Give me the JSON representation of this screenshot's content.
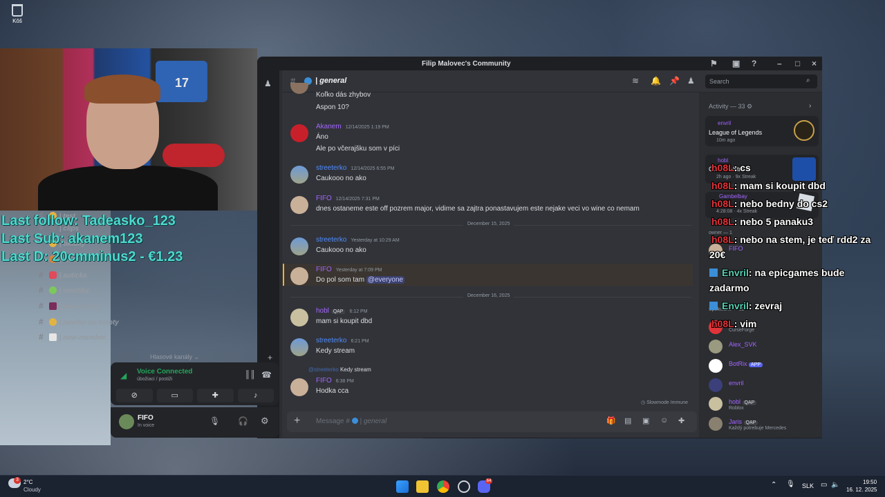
{
  "desktop": {
    "recycle_bin_label": "Kôš"
  },
  "overlay": {
    "last_follow": "Last follow: Tadeasko_123",
    "last_sub": "Last Sub: akanem123",
    "last_d": "Last D: 20cmminus2 - €1.23"
  },
  "window": {
    "title": "Filip Malovec's Community"
  },
  "channel_header": {
    "name": "| general",
    "search_placeholder": "Search"
  },
  "channels": [
    {
      "name": "| test",
      "icon": "fire-emoji"
    },
    {
      "name": "| clips",
      "icon": "film-emoji"
    },
    {
      "name": "| tiktoky",
      "icon": "smile-emoji"
    },
    {
      "name": "| food",
      "icon": "food-emoji"
    },
    {
      "name": "| auticka",
      "icon": "car-emoji"
    },
    {
      "name": "| emotiky",
      "icon": "alien-emoji"
    },
    {
      "name": "| bot-srandy",
      "icon": "hat-emoji"
    },
    {
      "name": "| navrhy-na-emoty",
      "icon": "thinking-emoji"
    },
    {
      "name": "| new-member",
      "icon": "memo-emoji"
    }
  ],
  "voice_channels_label": "Hlasové kanály",
  "mention_badge": "6",
  "voice": {
    "status": "Voice Connected",
    "location": "úbožiaci / postiži"
  },
  "user": {
    "name": "FIFO",
    "status": "In voice"
  },
  "messages": [
    {
      "author": "",
      "time": "",
      "lines": [
        "Koľko dás zhybov",
        "Aspon 10?"
      ]
    },
    {
      "author": "Akanem",
      "time": "12/14/2025 1:19 PM",
      "lines": [
        "Áno",
        "Ale po včerajšku som v píci"
      ]
    },
    {
      "author": "streeterko",
      "time": "12/14/2025 6:55 PM",
      "lines": [
        "Caukooo no ako"
      ]
    },
    {
      "author": "FIFO",
      "time": "12/14/2025 7:31 PM",
      "lines": [
        "dnes ostaneme este off pozrem major, vidime sa zajtra ponastavujem este nejake veci vo wine co nemam"
      ]
    },
    {
      "author": "streeterko",
      "time": "Yesterday at 10:29 AM",
      "lines": [
        "Caukooo no ako"
      ]
    },
    {
      "author": "FIFO",
      "time": "Yesterday at 7:09 PM",
      "lines": [
        "Do pol som tam"
      ],
      "mention": "@everyone"
    },
    {
      "author": "hobl",
      "badge": "QAP",
      "time": "6:12 PM",
      "lines": [
        "mam si koupit dbd"
      ]
    },
    {
      "author": "streeterko",
      "time": "6:21 PM",
      "lines": [
        "Kedy stream"
      ]
    },
    {
      "author": "FIFO",
      "time": "6:38 PM",
      "lines": [
        "Hodka cca"
      ],
      "reply_to": "@streeterko",
      "reply_text": "Kedy stream"
    }
  ],
  "dividers": [
    "December 15, 2025",
    "December 16, 2025"
  ],
  "slowmode": "Slowmode Immune",
  "composer": {
    "placeholder": "Message #",
    "channel": "| general"
  },
  "activity": {
    "header": "Activity — 33",
    "card": {
      "user": "envril",
      "game": "League of Legends",
      "time": "10m ago"
    },
    "card2": {
      "user": "hobl",
      "game": "Counter-Strike",
      "time": "2h ago",
      "streak": "9x Streak"
    },
    "card3": {
      "user": "Gambelbay",
      "time": "4:28:08",
      "streak": "4x Streak"
    },
    "owner_label": "owner — 1",
    "spekulanti_label": "Špekulanti — 12"
  },
  "members": [
    {
      "name": "FIFO",
      "status": ""
    },
    {
      "name": "CurseForge",
      "status": ""
    },
    {
      "name": "Alex_SVK",
      "status": ""
    },
    {
      "name": "BotRix",
      "badge": "APP",
      "status": ""
    },
    {
      "name": "envril",
      "status": ""
    },
    {
      "name": "hobl",
      "badge": "QAP",
      "status": "Roblox"
    },
    {
      "name": "Jaris",
      "badge": "QAP",
      "status": "Každý potrebuje Mercedes"
    }
  ],
  "stream_chat": [
    {
      "user": "h08L",
      "text": ": cs"
    },
    {
      "user": "h08L",
      "text": ": mam si koupit dbd"
    },
    {
      "user": "h08L",
      "text": ": nebo bedny do cs2"
    },
    {
      "user": "h08L",
      "text": ": nebo 5 panaku3"
    },
    {
      "user": "h08L",
      "text": ": nebo na stem, je teď rdd2 za"
    },
    {
      "user": "",
      "text": "20€"
    },
    {
      "user": "Envril",
      "text": ": na epicgames bude"
    },
    {
      "user": "",
      "text": "zadarmo"
    },
    {
      "user": "Envril",
      "text": ": zevraj"
    },
    {
      "user": "h08L",
      "text": ": vim"
    }
  ],
  "taskbar": {
    "weather_temp": "2°C",
    "weather_desc": "Cloudy",
    "weather_badge": "3",
    "language": "SLK",
    "time": "19:50",
    "date": "16. 12. 2025",
    "discord_badge": "64"
  },
  "colors": {
    "blurple": "#5865f2",
    "voice_green": "#23a55a",
    "overlay_cyan": "#4fd8d0",
    "chat_red": "#e0343a",
    "fifo_purple": "#a366ff",
    "streeterko_blue": "#4f8cff"
  }
}
